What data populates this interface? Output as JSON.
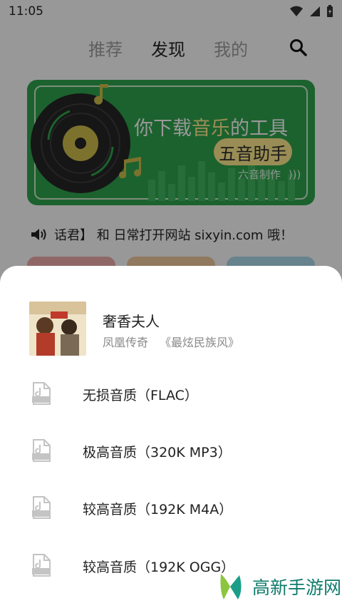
{
  "status_bar": {
    "time": "11:05"
  },
  "nav": {
    "tabs": [
      "推荐",
      "发现",
      "我的"
    ],
    "active_tab": "发现"
  },
  "banner": {
    "title_prefix": "你下载",
    "title_highlight": "音乐",
    "title_suffix": "的工具",
    "subtitle": "五音助手",
    "credit": "六音制作"
  },
  "notice": {
    "text": "话君】 和 日常打开网站 sixyin.com 哦！"
  },
  "song": {
    "title": "奢香夫人",
    "artist": "凤凰传奇",
    "album": "《最炫民族风》"
  },
  "quality_options": [
    {
      "label": "无损音质（FLAC）",
      "icon": "flac-file-icon"
    },
    {
      "label": "极高音质（320K MP3）",
      "icon": "mp3-file-icon"
    },
    {
      "label": "较高音质（192K M4A）",
      "icon": "m4a-file-icon"
    },
    {
      "label": "较高音质（192K OGG）",
      "icon": "ogg-file-icon"
    }
  ],
  "watermark": {
    "text": "高新手游网"
  },
  "colors": {
    "banner_green": "#2e9e4b",
    "banner_yellow": "#f7e48a",
    "watermark_teal": "#0f7b6b"
  }
}
